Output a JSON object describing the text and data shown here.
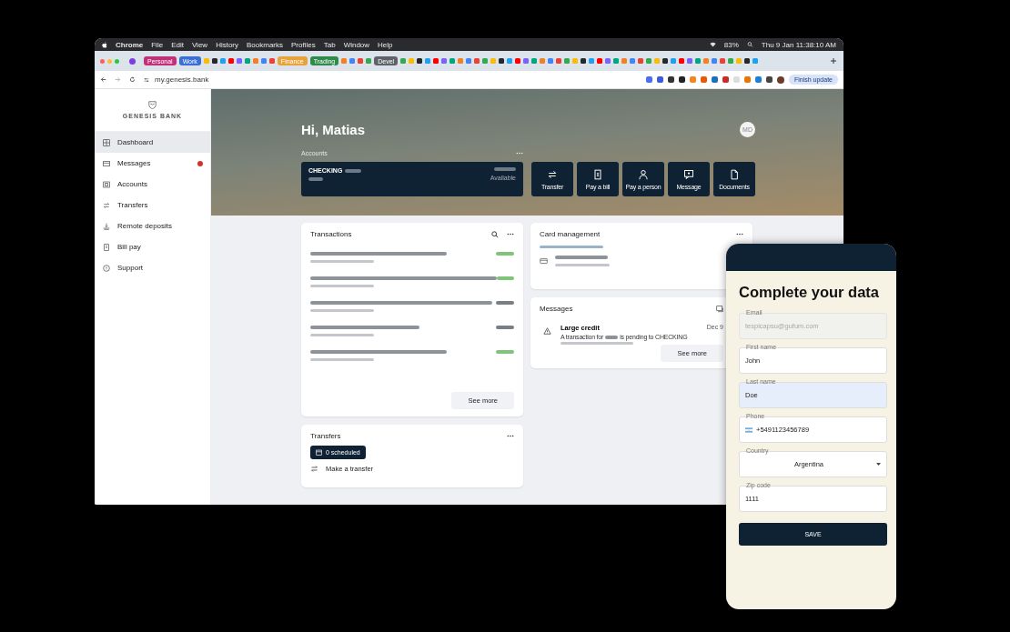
{
  "menubar": {
    "app": "Chrome",
    "menus": [
      "File",
      "Edit",
      "View",
      "History",
      "Bookmarks",
      "Profiles",
      "Tab",
      "Window",
      "Help"
    ],
    "battery": "83%",
    "clock": "Thu 9 Jan 11:38:10 AM"
  },
  "tab_groups": [
    {
      "label": "Personal",
      "color": "#c2307a"
    },
    {
      "label": "Work",
      "color": "#3a6fd8"
    },
    {
      "label": "Finance",
      "color": "#e8a23a"
    },
    {
      "label": "Trading",
      "color": "#2e8b4a"
    },
    {
      "label": "Devel",
      "color": "#5f6368"
    }
  ],
  "address_bar": {
    "url": "my.genesis.bank",
    "update_button": "Finish update"
  },
  "sidebar": {
    "brand": "GENESIS BANK",
    "items": [
      {
        "kind": "dashboard",
        "label": "Dashboard",
        "selected": true,
        "badge": false
      },
      {
        "kind": "messages",
        "label": "Messages",
        "selected": false,
        "badge": true
      },
      {
        "kind": "accounts",
        "label": "Accounts",
        "selected": false,
        "badge": false
      },
      {
        "kind": "transfers",
        "label": "Transfers",
        "selected": false,
        "badge": false
      },
      {
        "kind": "deposits",
        "label": "Remote deposits",
        "selected": false,
        "badge": false
      },
      {
        "kind": "bills",
        "label": "Bill pay",
        "selected": false,
        "badge": false
      },
      {
        "kind": "support",
        "label": "Support",
        "selected": false,
        "badge": false
      }
    ]
  },
  "hero": {
    "greeting": "Hi, Matias",
    "avatar": "MD",
    "accounts_label": "Accounts",
    "account": {
      "name": "CHECKING",
      "status": "Available"
    },
    "actions": [
      {
        "kind": "transfer",
        "label": "Transfer"
      },
      {
        "kind": "bill",
        "label": "Pay a bill"
      },
      {
        "kind": "person",
        "label": "Pay a person"
      },
      {
        "kind": "message",
        "label": "Message"
      },
      {
        "kind": "document",
        "label": "Documents"
      }
    ]
  },
  "transactions": {
    "title": "Transactions",
    "rows": [
      {
        "kind": "credit"
      },
      {
        "kind": "credit"
      },
      {
        "kind": "debit"
      },
      {
        "kind": "debit"
      },
      {
        "kind": "credit"
      }
    ],
    "more": "See more"
  },
  "transfers": {
    "title": "Transfers",
    "scheduled": "0 scheduled",
    "action": "Make a transfer"
  },
  "card_management": {
    "title": "Card management"
  },
  "messages": {
    "title": "Messages",
    "items": [
      {
        "title": "Large credit",
        "text_start": "A transaction for",
        "text_end": "is pending to CHECKING",
        "date": "Dec 9"
      }
    ],
    "more": "See more"
  },
  "form": {
    "title": "Complete your data",
    "fields": [
      {
        "kind": "text",
        "label": "Email",
        "value": "tespicapsu@gufum.com",
        "disabled": true,
        "highlighted": false
      },
      {
        "kind": "text",
        "label": "First name",
        "value": "John",
        "disabled": false,
        "highlighted": false
      },
      {
        "kind": "text",
        "label": "Last name",
        "value": "Doe",
        "disabled": false,
        "highlighted": true
      },
      {
        "kind": "phone",
        "label": "Phone",
        "value": "+5491123456789",
        "disabled": false,
        "highlighted": false
      },
      {
        "kind": "select",
        "label": "Country",
        "value": "Argentina",
        "disabled": false,
        "highlighted": false
      },
      {
        "kind": "text",
        "label": "Zip code",
        "value": "1111",
        "disabled": false,
        "highlighted": false
      }
    ],
    "submit": "SAVE"
  }
}
